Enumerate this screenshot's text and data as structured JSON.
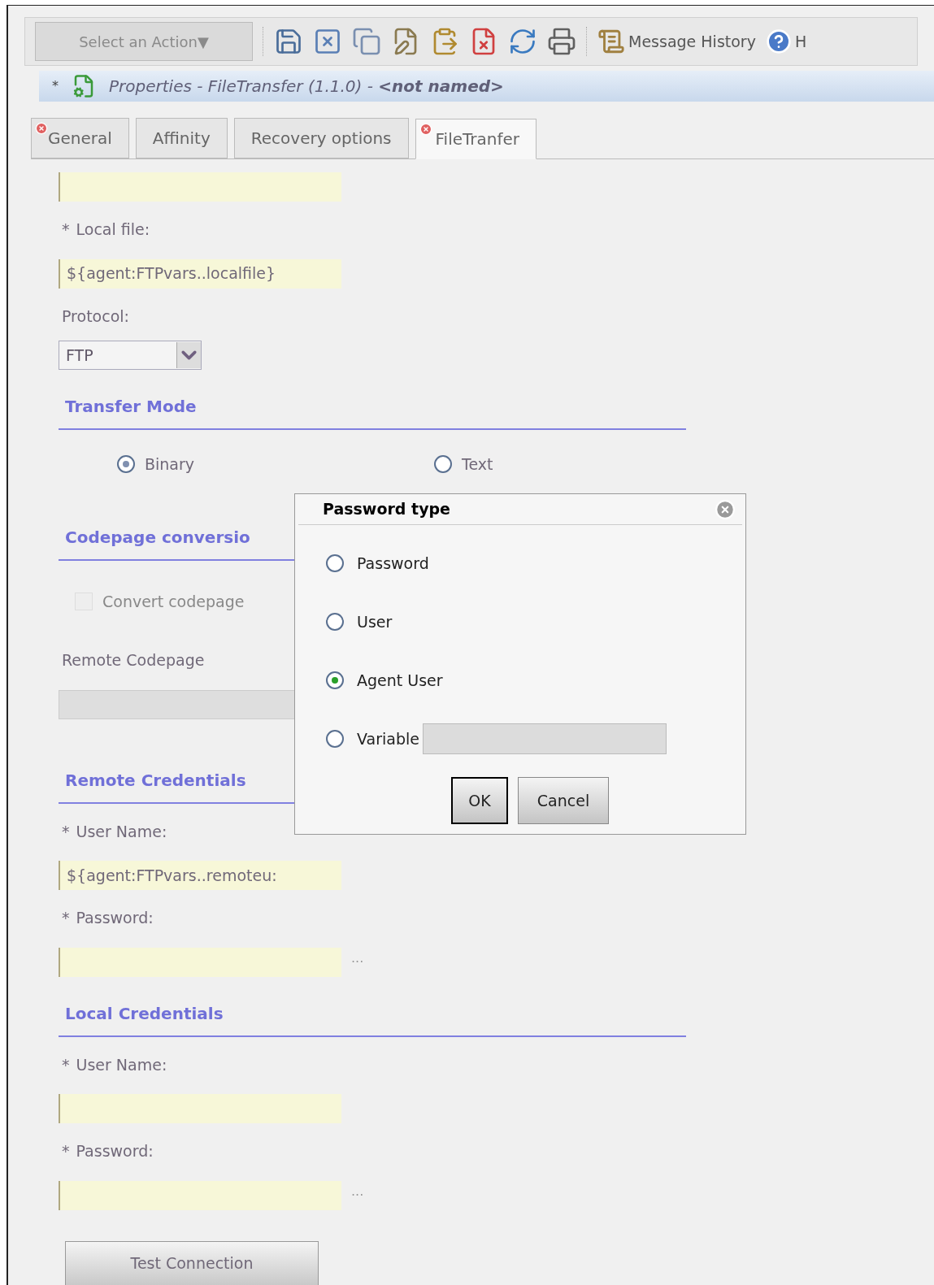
{
  "toolbar": {
    "action_button": {
      "label": "Select an Action▼",
      "disabled": true
    },
    "tools": [
      {
        "kind": "save"
      },
      {
        "kind": "close"
      },
      {
        "kind": "copy"
      },
      {
        "kind": "edit"
      },
      {
        "kind": "paste"
      },
      {
        "kind": "delete"
      },
      {
        "kind": "refresh"
      },
      {
        "kind": "print"
      }
    ],
    "message_history": "Message History",
    "help": "H"
  },
  "title_bar": {
    "modified_mark": "*",
    "text": "Properties - FileTransfer (1.1.0) - **<not named>**"
  },
  "tabs": [
    {
      "label": "General",
      "error": true,
      "selected": false
    },
    {
      "label": "Affinity",
      "error": false,
      "selected": false
    },
    {
      "label": "Recovery options",
      "error": false,
      "selected": false
    },
    {
      "label": "FileTranfer",
      "error": true,
      "selected": true
    }
  ],
  "form": [
    {
      "kind": "field",
      "disabled": false
    },
    {
      "kind": "label",
      "text": "Local file:",
      "required": true
    },
    {
      "kind": "field",
      "value": "${agent:FTPvars..localfile}",
      "disabled": false
    },
    {
      "kind": "label",
      "text": "Protocol:",
      "required": false
    },
    {
      "kind": "select",
      "value": "FTP"
    },
    {
      "kind": "heading",
      "text": "Transfer Mode"
    },
    {
      "kind": "radios",
      "options": [
        {
          "label": "Binary",
          "selected": true
        },
        {
          "label": "Text",
          "selected": false
        }
      ]
    },
    {
      "kind": "heading",
      "text": "Codepage conversio"
    },
    {
      "kind": "checkbox",
      "label": "Convert codepage",
      "checked": false,
      "disabled": true
    },
    {
      "kind": "label",
      "text": "Remote Codepage",
      "required": false
    },
    {
      "kind": "field",
      "disabled": true
    },
    {
      "kind": "heading",
      "text": "Remote Credentials"
    },
    {
      "kind": "label",
      "text": "User Name:",
      "required": true
    },
    {
      "kind": "field",
      "value": "${agent:FTPvars..remoteu:",
      "disabled": false
    },
    {
      "kind": "label",
      "text": "Password:",
      "required": true
    },
    {
      "kind": "field",
      "browse": "···",
      "disabled": false
    },
    {
      "kind": "heading",
      "text": "Local Credentials"
    },
    {
      "kind": "label",
      "text": "User Name:",
      "required": true
    },
    {
      "kind": "field",
      "disabled": false
    },
    {
      "kind": "label",
      "text": "Password:",
      "required": true
    },
    {
      "kind": "field",
      "browse": "···",
      "disabled": false
    },
    {
      "kind": "button",
      "label": "Test Connection"
    }
  ],
  "dialog": {
    "title": "Password type",
    "options": [
      {
        "label": "Password",
        "selected": false
      },
      {
        "label": "User",
        "selected": false
      },
      {
        "label": "Agent User",
        "selected": true
      },
      {
        "label": "Variable",
        "selected": false,
        "has_field": true,
        "field_disabled": true
      }
    ],
    "buttons": [
      {
        "label": "OK",
        "focused": true
      },
      {
        "label": "Cancel",
        "focused": false
      }
    ]
  }
}
